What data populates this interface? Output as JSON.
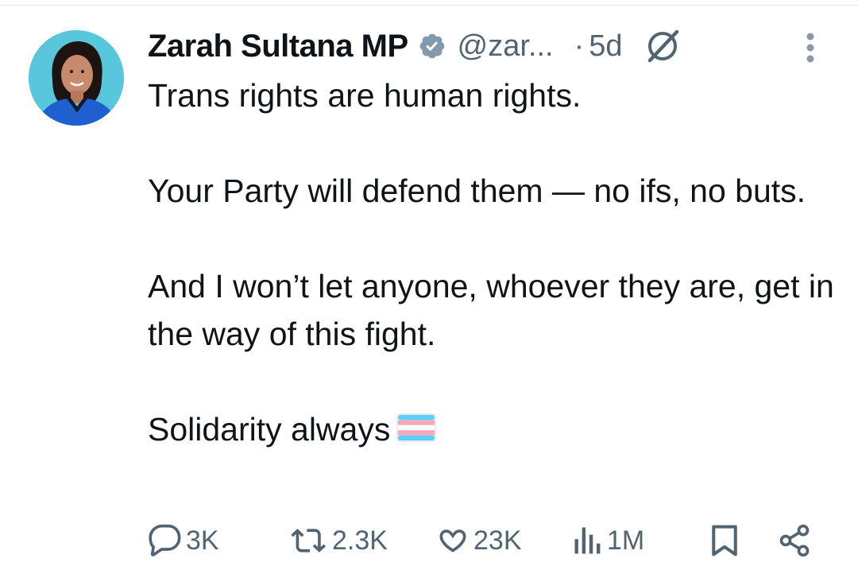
{
  "tweet": {
    "author": {
      "display_name": "Zarah Sultana MP",
      "handle": "@zar...",
      "verified": true
    },
    "separator": "·",
    "age": "5d",
    "paragraphs": [
      "Trans rights are human rights.",
      "Your Party will defend them — no ifs, no buts.",
      "And I won’t let anyone, whoever they are, get in the way of this fight.",
      "Solidarity always"
    ],
    "trailing_emoji": "transgender-flag"
  },
  "actions": {
    "replies": "3K",
    "reposts": "2.3K",
    "likes": "23K",
    "views": "1M"
  },
  "colors": {
    "text": "#0f1419",
    "secondary": "#536471",
    "avatar_bg": "#58c7dc",
    "verified_badge": "#829aab",
    "flag_blue": "#5bcefa",
    "flag_pink": "#f5a9b8",
    "flag_white": "#ffffff"
  },
  "icons": [
    "verified-badge-icon",
    "grok-icon",
    "more-icon",
    "reply-icon",
    "repost-icon",
    "like-icon",
    "views-icon",
    "bookmark-icon",
    "share-icon"
  ]
}
